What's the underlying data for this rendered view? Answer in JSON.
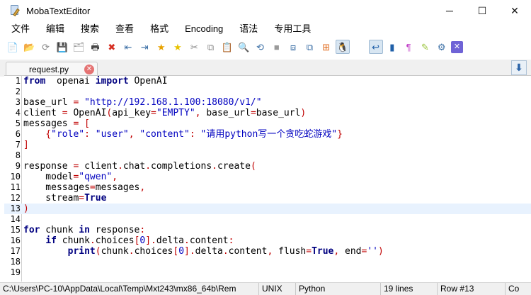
{
  "window": {
    "title": "MobaTextEditor",
    "minimize_glyph": "─",
    "maximize_glyph": "☐",
    "close_glyph": "✕"
  },
  "menu": [
    "文件",
    "编辑",
    "搜索",
    "查看",
    "格式",
    "Encoding",
    "语法",
    "专用工具"
  ],
  "toolbar": {
    "icons": [
      {
        "name": "new-file-icon",
        "glyph": "📄",
        "color": "#6a9bd1"
      },
      {
        "name": "open-folder-icon",
        "glyph": "📂",
        "color": "#e0a62a"
      },
      {
        "name": "reload-icon",
        "glyph": "⟳",
        "color": "#888888"
      },
      {
        "name": "save-icon",
        "glyph": "💾",
        "color": "#9a9a9a"
      },
      {
        "name": "save-all-icon",
        "glyph": "🗂",
        "color": "#9a9a9a"
      },
      {
        "name": "print-icon",
        "glyph": "🖶",
        "color": "#444444"
      },
      {
        "name": "close-file-icon",
        "glyph": "✖",
        "color": "#d62d20"
      },
      {
        "name": "indent-icon",
        "glyph": "⇤",
        "color": "#3a6ea5"
      },
      {
        "name": "unindent-icon",
        "glyph": "⇥",
        "color": "#3a6ea5"
      },
      {
        "name": "bookmark-icon",
        "glyph": "★",
        "color": "#e8a200"
      },
      {
        "name": "bookmark-next-icon",
        "glyph": "★",
        "color": "#e8c200"
      },
      {
        "name": "cut-icon",
        "glyph": "✂",
        "color": "#888888"
      },
      {
        "name": "copy-icon",
        "glyph": "⧉",
        "color": "#888888"
      },
      {
        "name": "paste-icon",
        "glyph": "📋",
        "color": "#3a6ea5"
      },
      {
        "name": "find-icon",
        "glyph": "🔍",
        "color": "#3a6ea5"
      },
      {
        "name": "find-replace-icon",
        "glyph": "⟲",
        "color": "#3a6ea5"
      },
      {
        "name": "gray-box-icon",
        "glyph": "■",
        "color": "#9a9a9a"
      },
      {
        "name": "compare-icon",
        "glyph": "⧈",
        "color": "#3a6ea5"
      },
      {
        "name": "merge-icon",
        "glyph": "⧉",
        "color": "#3a6ea5"
      },
      {
        "name": "windows-icon",
        "glyph": "⊞",
        "color": "#e06a1b"
      },
      {
        "name": "linux-icon",
        "glyph": "🐧",
        "color": "#222222"
      },
      {
        "name": "apple-icon",
        "glyph": "",
        "color": "#2a72c9"
      },
      {
        "name": "word-wrap-icon",
        "glyph": "↩",
        "color": "#1f5fa8"
      },
      {
        "name": "column-icon",
        "glyph": "▮",
        "color": "#1f5fa8"
      },
      {
        "name": "pilcrow-icon",
        "glyph": "¶",
        "color": "#c13fc8"
      },
      {
        "name": "highlighter-icon",
        "glyph": "✎",
        "color": "#9ac33a"
      },
      {
        "name": "settings-icon",
        "glyph": "⚙",
        "color": "#3a6ea5"
      },
      {
        "name": "close-panel-icon",
        "glyph": "✕",
        "color": "#ffffff"
      }
    ]
  },
  "tab": {
    "label": "request.py",
    "close_glyph": "✕",
    "nav_glyph": "⬇"
  },
  "editor": {
    "current_line": 13,
    "lines": [
      {
        "n": "1",
        "t": [
          [
            "kw",
            "from"
          ],
          [
            "",
            "  openai "
          ],
          [
            "kw",
            "import"
          ],
          [
            "",
            " OpenAI"
          ]
        ]
      },
      {
        "n": "2",
        "t": []
      },
      {
        "n": "3",
        "t": [
          [
            "",
            "base_url "
          ],
          [
            "op",
            "="
          ],
          [
            "",
            " "
          ],
          [
            "str",
            "\"http://192.168.1.100:18080/v1/\""
          ]
        ]
      },
      {
        "n": "4",
        "t": [
          [
            "",
            "client "
          ],
          [
            "op",
            "="
          ],
          [
            "",
            " OpenAI"
          ],
          [
            "op",
            "("
          ],
          [
            "",
            "api_key"
          ],
          [
            "op",
            "="
          ],
          [
            "str",
            "\"EMPTY\""
          ],
          [
            "op",
            ","
          ],
          [
            "",
            " base_url"
          ],
          [
            "op",
            "="
          ],
          [
            "",
            "base_url"
          ],
          [
            "op",
            ")"
          ]
        ]
      },
      {
        "n": "5",
        "t": [
          [
            "",
            "messages "
          ],
          [
            "op",
            "="
          ],
          [
            "",
            " "
          ],
          [
            "op",
            "["
          ]
        ]
      },
      {
        "n": "6",
        "t": [
          [
            "",
            "    "
          ],
          [
            "op",
            "{"
          ],
          [
            "str",
            "\"role\""
          ],
          [
            "op",
            ":"
          ],
          [
            "",
            " "
          ],
          [
            "str",
            "\"user\""
          ],
          [
            "op",
            ","
          ],
          [
            "",
            " "
          ],
          [
            "str",
            "\"content\""
          ],
          [
            "op",
            ":"
          ],
          [
            "",
            " "
          ],
          [
            "str",
            "\"请用python写一个贪吃蛇游戏\""
          ],
          [
            "op",
            "}"
          ]
        ]
      },
      {
        "n": "7",
        "t": [
          [
            "op",
            "]"
          ]
        ]
      },
      {
        "n": "8",
        "t": []
      },
      {
        "n": "9",
        "t": [
          [
            "",
            "response "
          ],
          [
            "op",
            "="
          ],
          [
            "",
            " client"
          ],
          [
            "op",
            "."
          ],
          [
            "",
            "chat"
          ],
          [
            "op",
            "."
          ],
          [
            "",
            "completions"
          ],
          [
            "op",
            "."
          ],
          [
            "",
            "create"
          ],
          [
            "op",
            "("
          ]
        ]
      },
      {
        "n": "10",
        "t": [
          [
            "",
            "    model"
          ],
          [
            "op",
            "="
          ],
          [
            "str",
            "\"qwen\""
          ],
          [
            "op",
            ","
          ]
        ]
      },
      {
        "n": "11",
        "t": [
          [
            "",
            "    messages"
          ],
          [
            "op",
            "="
          ],
          [
            "",
            "messages"
          ],
          [
            "op",
            ","
          ]
        ]
      },
      {
        "n": "12",
        "t": [
          [
            "",
            "    stream"
          ],
          [
            "op",
            "="
          ],
          [
            "kw",
            "True"
          ]
        ]
      },
      {
        "n": "13",
        "t": [
          [
            "op",
            ")"
          ]
        ]
      },
      {
        "n": "14",
        "t": []
      },
      {
        "n": "15",
        "t": [
          [
            "kw",
            "for"
          ],
          [
            "",
            " chunk "
          ],
          [
            "kw",
            "in"
          ],
          [
            "",
            " response"
          ],
          [
            "op",
            ":"
          ]
        ]
      },
      {
        "n": "16",
        "t": [
          [
            "",
            "    "
          ],
          [
            "kw",
            "if"
          ],
          [
            "",
            " chunk"
          ],
          [
            "op",
            "."
          ],
          [
            "",
            "choices"
          ],
          [
            "op",
            "["
          ],
          [
            "str",
            "0"
          ],
          [
            "op",
            "]."
          ],
          [
            "",
            "delta"
          ],
          [
            "op",
            "."
          ],
          [
            "",
            "content"
          ],
          [
            "op",
            ":"
          ]
        ]
      },
      {
        "n": "17",
        "t": [
          [
            "",
            "        "
          ],
          [
            "kw",
            "print"
          ],
          [
            "op",
            "("
          ],
          [
            "",
            "chunk"
          ],
          [
            "op",
            "."
          ],
          [
            "",
            "choices"
          ],
          [
            "op",
            "["
          ],
          [
            "str",
            "0"
          ],
          [
            "op",
            "]."
          ],
          [
            "",
            "delta"
          ],
          [
            "op",
            "."
          ],
          [
            "",
            "content"
          ],
          [
            "op",
            ","
          ],
          [
            "",
            " flush"
          ],
          [
            "op",
            "="
          ],
          [
            "kw",
            "True"
          ],
          [
            "op",
            ","
          ],
          [
            "",
            " end"
          ],
          [
            "op",
            "="
          ],
          [
            "str",
            "''"
          ],
          [
            "op",
            ")"
          ]
        ]
      },
      {
        "n": "18",
        "t": []
      },
      {
        "n": "19",
        "t": []
      }
    ]
  },
  "status": {
    "path": "C:\\Users\\PC-10\\AppData\\Local\\Temp\\Mxt243\\mx86_64b\\Rem",
    "line_endings": "UNIX",
    "syntax": "Python",
    "line_count": "19 lines",
    "row": "Row #13",
    "col": "Co"
  }
}
